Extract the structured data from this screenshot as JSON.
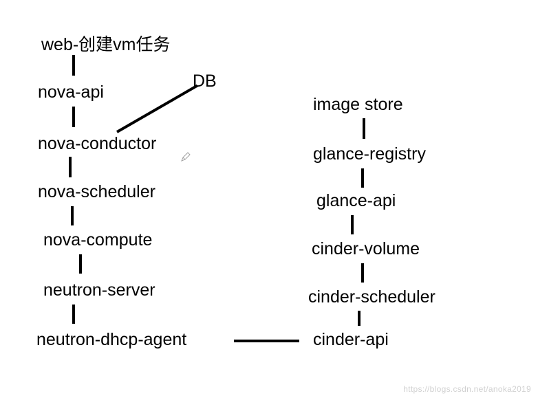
{
  "left_column": {
    "n0": "web-创建vm任务",
    "n1": "nova-api",
    "n2": "nova-conductor",
    "n3": "nova-scheduler",
    "n4": "nova-compute",
    "n5": "neutron-server",
    "n6": "neutron-dhcp-agent"
  },
  "right_column": {
    "r0": "image store",
    "r1": "glance-registry",
    "r2": "glance-api",
    "r3": "cinder-volume",
    "r4": "cinder-scheduler",
    "r5": "cinder-api"
  },
  "extra": {
    "db": "DB"
  },
  "watermark": "https://blogs.csdn.net/anoka2019",
  "pencil_icon": "pencil-icon"
}
